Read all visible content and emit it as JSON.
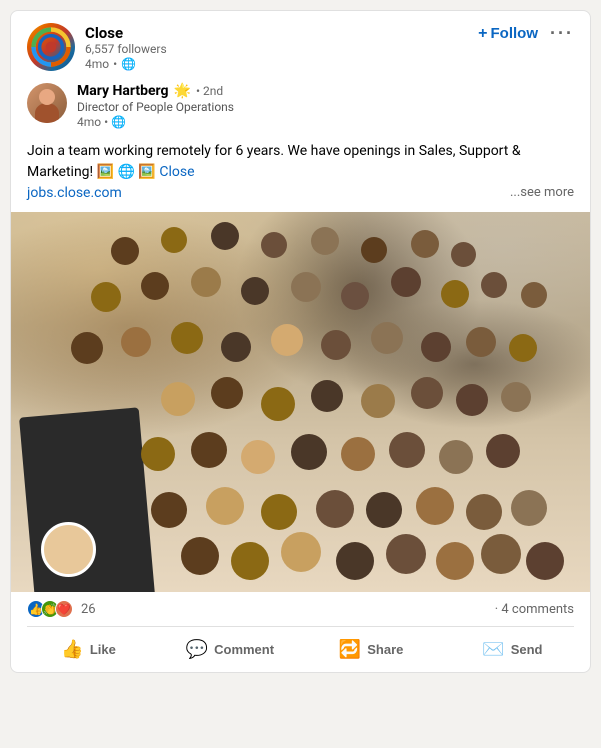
{
  "card": {
    "company": {
      "name": "Close",
      "followers": "6,557 followers",
      "time": "4mo",
      "privacy": "🌐"
    },
    "header": {
      "follow_label": "Follow",
      "more_label": "···",
      "close_label": "Close"
    },
    "author": {
      "name": "Mary Hartberg",
      "sun_emoji": "🌟",
      "connection": "• 2nd",
      "title": "Director of People Operations",
      "time": "4mo",
      "privacy": "🌐"
    },
    "post": {
      "text_part1": "Join a team working remotely for 6 years. We have openings in Sales, Support & Marketing! 🖼️ 🌐 🖼️",
      "link_text": "Close",
      "jobs_url": "jobs.close.com",
      "see_more": "...see more"
    },
    "reactions": {
      "count": "26",
      "dot": "·",
      "comments": "4 comments"
    },
    "actions": {
      "like": "Like",
      "comment": "Comment",
      "share": "Share",
      "send": "Send"
    }
  }
}
